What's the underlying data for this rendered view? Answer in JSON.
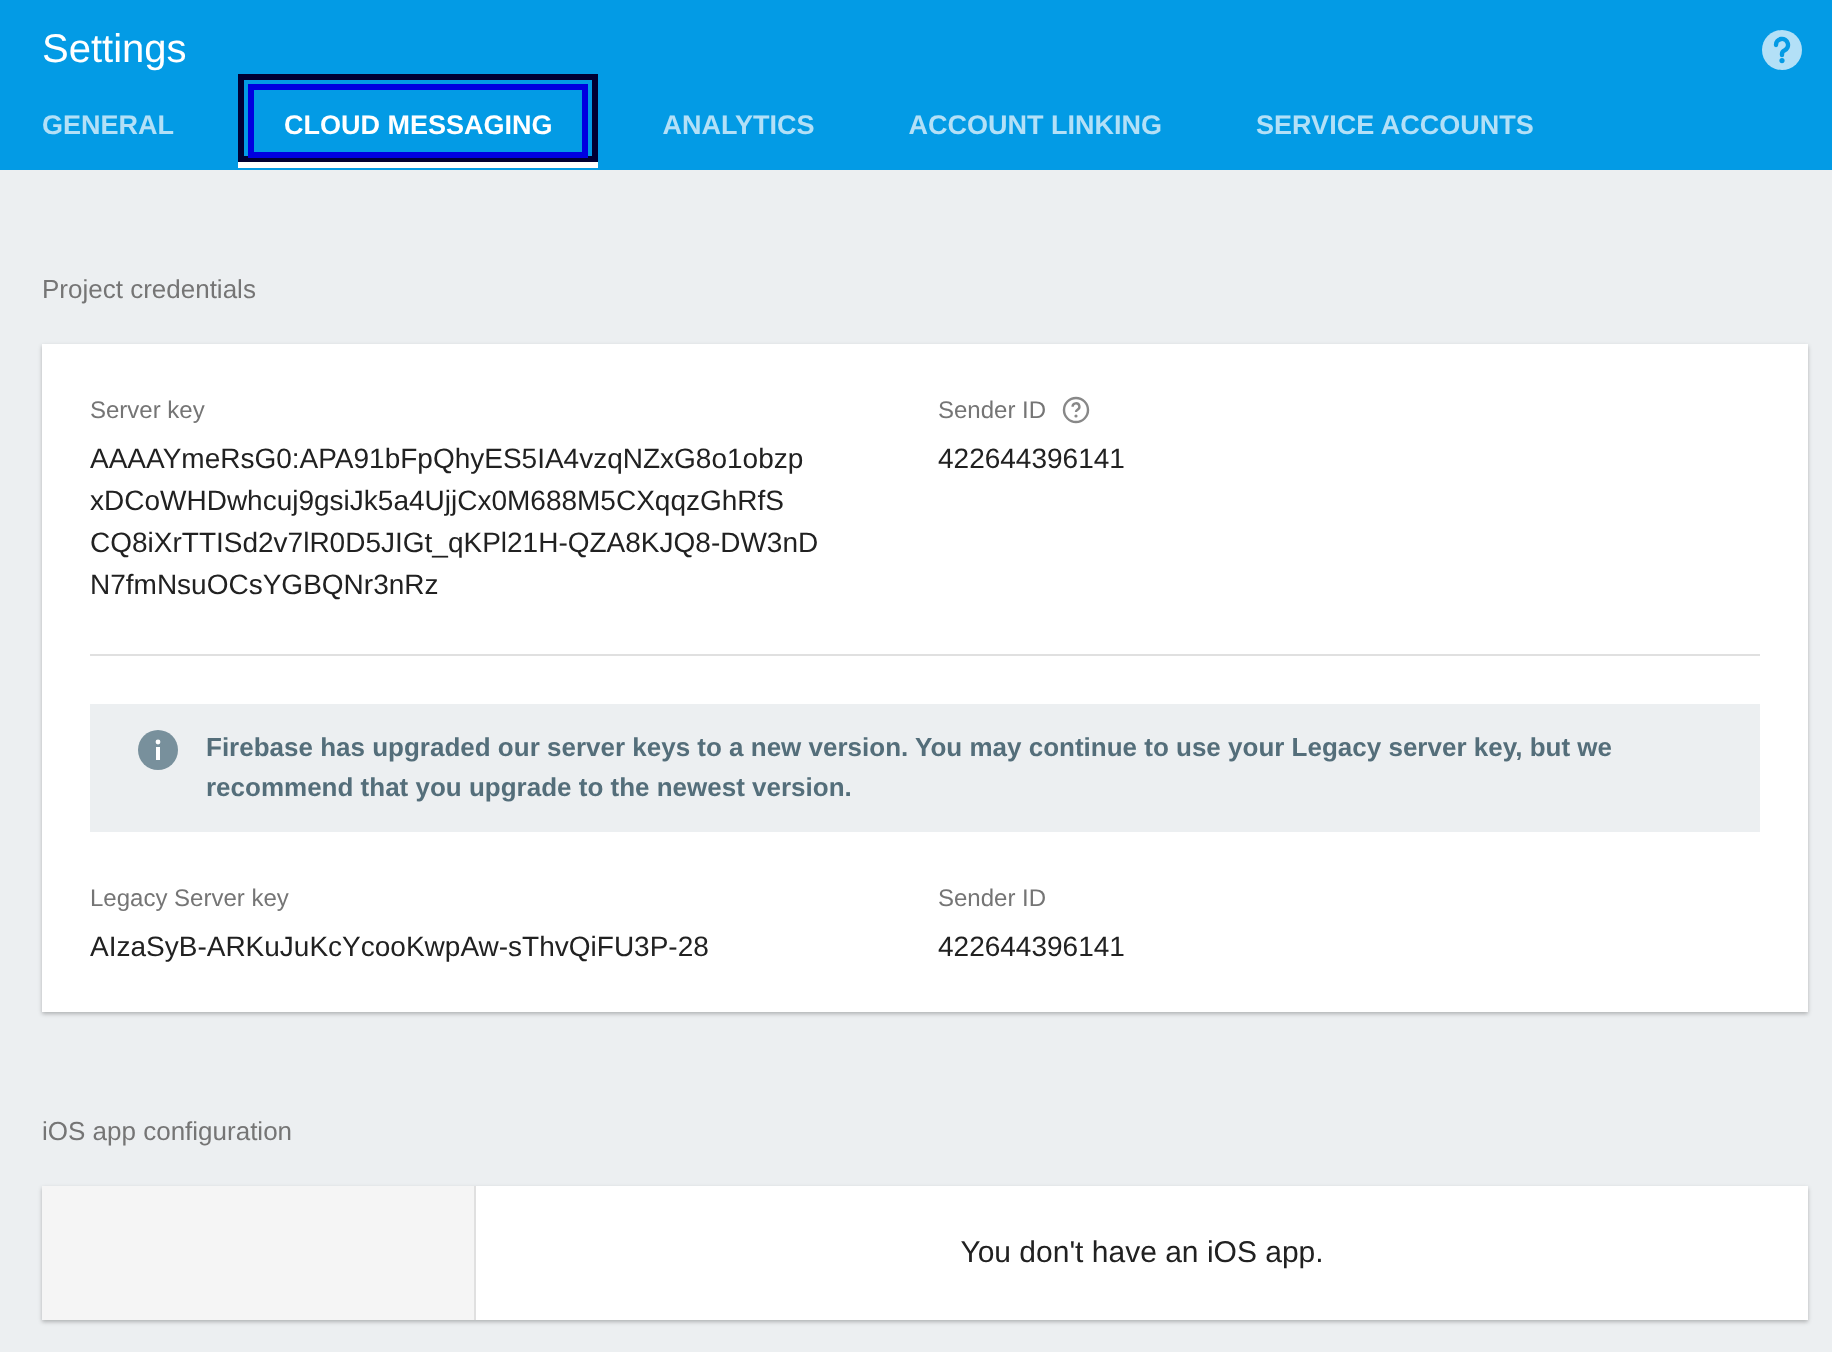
{
  "header": {
    "title": "Settings"
  },
  "tabs": [
    {
      "label": "GENERAL",
      "selected": false,
      "highlighted": false
    },
    {
      "label": "CLOUD MESSAGING",
      "selected": true,
      "highlighted": true
    },
    {
      "label": "ANALYTICS",
      "selected": false,
      "highlighted": false
    },
    {
      "label": "ACCOUNT LINKING",
      "selected": false,
      "highlighted": false
    },
    {
      "label": "SERVICE ACCOUNTS",
      "selected": false,
      "highlighted": false
    }
  ],
  "project_credentials": {
    "heading": "Project credentials",
    "server_key": {
      "label": "Server key",
      "value_lines": [
        "AAAAYmeRsG0:APA91bFpQhyES5IA4vzqNZxG8o1obzp",
        "xDCoWHDwhcuj9gsiJk5a4UjjCx0M688M5CXqqzGhRfS",
        "CQ8iXrTTISd2v7lR0D5JIGt_qKPl21H-QZA8KJQ8-DW3nD",
        "N7fmNsuOCsYGBQNr3nRz"
      ]
    },
    "sender_id": {
      "label": "Sender ID",
      "value": "422644396141"
    },
    "notice": "Firebase has upgraded our server keys to a new version. You may continue to use your Legacy server key, but we recommend that you upgrade to the newest version.",
    "legacy_key": {
      "label": "Legacy Server key",
      "value": "AIzaSyB-ARKuJuKcYcooKwpAw-sThvQiFU3P-28"
    },
    "legacy_sender_id": {
      "label": "Sender ID",
      "value": "422644396141"
    }
  },
  "ios": {
    "heading": "iOS app configuration",
    "message": "You don't have an iOS app."
  }
}
